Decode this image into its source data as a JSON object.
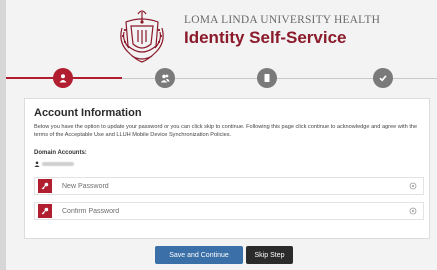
{
  "header": {
    "org_name": "LOMA LINDA UNIVERSITY HEALTH",
    "app_title": "Identity Self-Service",
    "brand_color": "#b01e2f",
    "logo_icon": "university-crest-logo"
  },
  "steps": [
    {
      "icon": "user-icon",
      "state": "active"
    },
    {
      "icon": "users-icon",
      "state": "inactive"
    },
    {
      "icon": "document-icon",
      "state": "inactive"
    },
    {
      "icon": "check-icon",
      "state": "inactive"
    }
  ],
  "panel": {
    "title": "Account Information",
    "description": "Below you have the option to update your password or you can click skip to continue. Following this page click continue to acknowledge and agree with the terms of the Acceptable Use and LLUH Mobile Device Synchronization Policies.",
    "domain_label": "Domain Accounts:",
    "new_password_placeholder": "New Password",
    "confirm_password_placeholder": "Confirm Password"
  },
  "buttons": {
    "save_label": "Save and Continue",
    "skip_label": "Skip Step",
    "save_color": "#3a6fa7",
    "skip_color": "#2b2b2b"
  }
}
